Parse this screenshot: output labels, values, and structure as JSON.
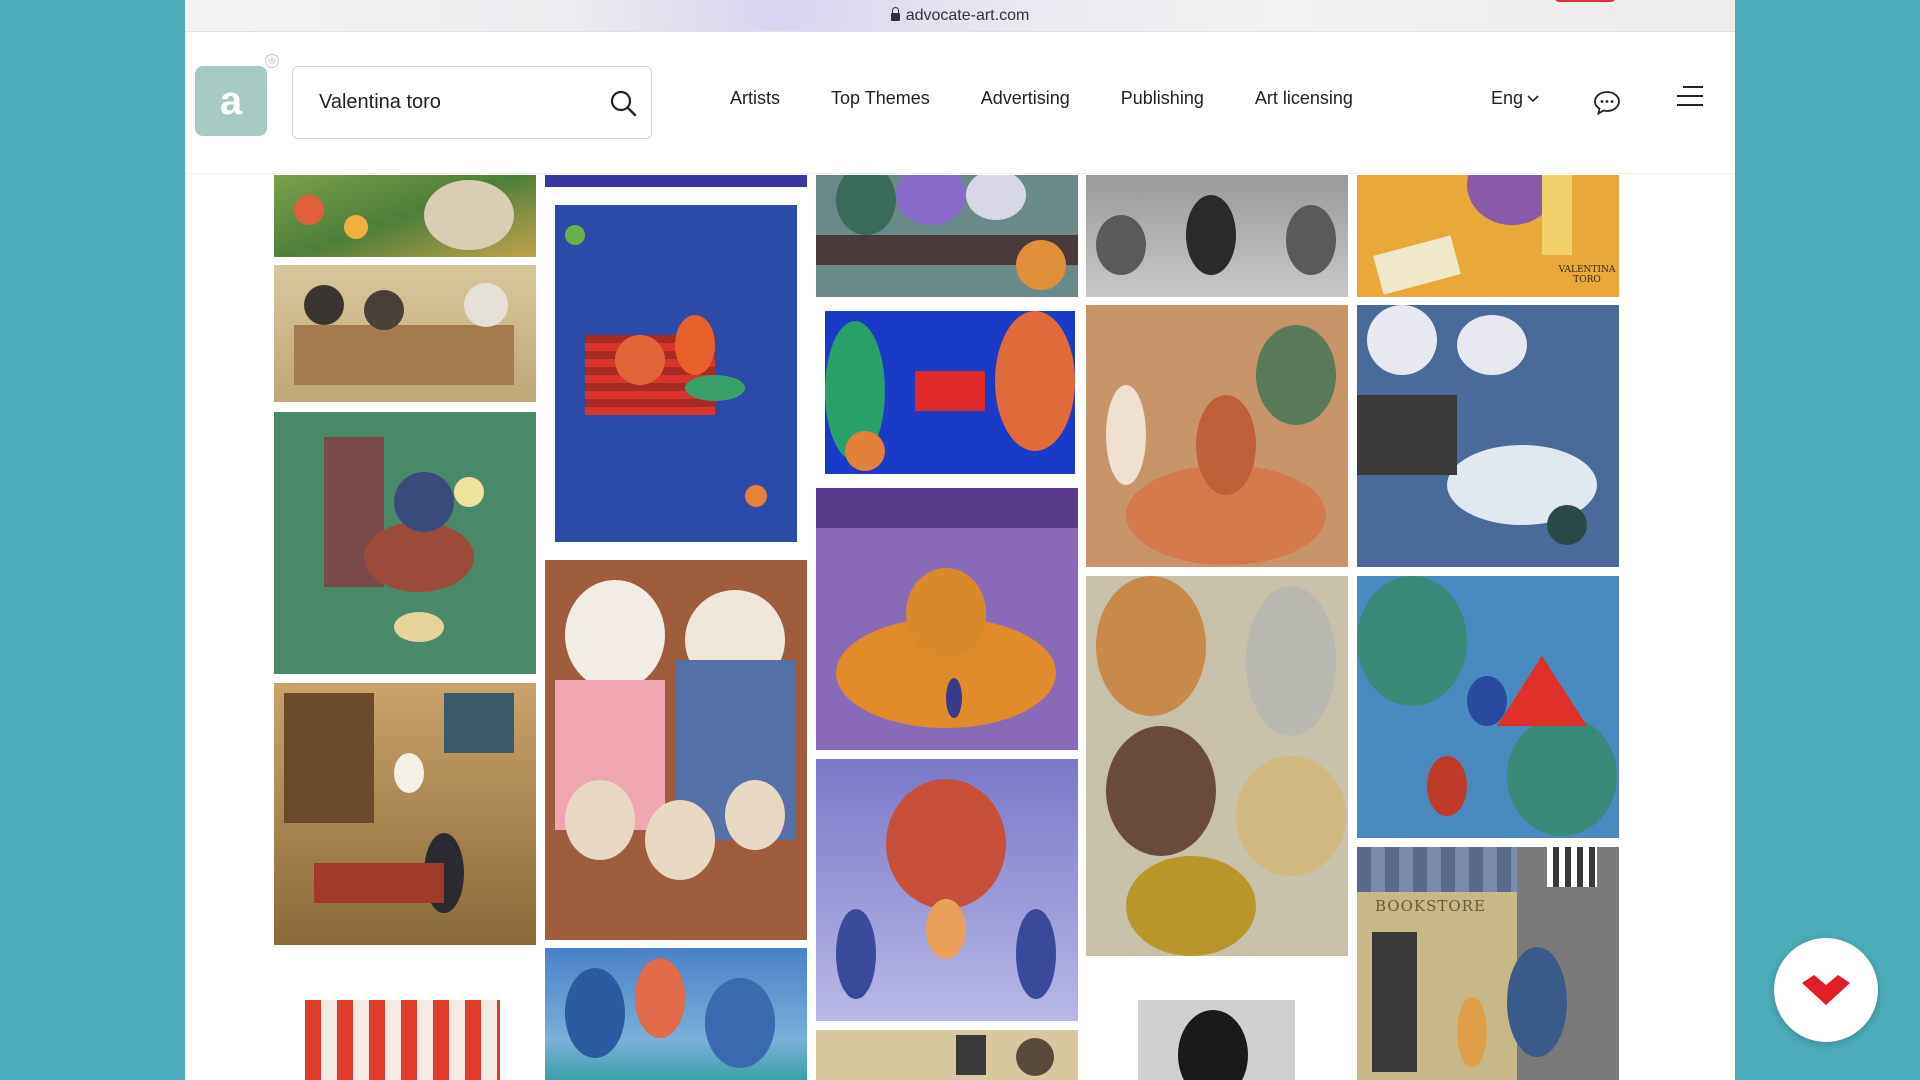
{
  "browser": {
    "url": "advocate-art.com"
  },
  "header": {
    "logo_letter": "a",
    "registered_mark": "®",
    "search": {
      "value": "Valentina toro",
      "placeholder": ""
    },
    "nav": [
      "Artists",
      "Top Themes",
      "Advertising",
      "Publishing",
      "Art licensing"
    ],
    "language": "Eng"
  },
  "colors": {
    "background": "#4cabb8",
    "logo": "#a6c9c4",
    "badge_logo": "#e01e26"
  },
  "icons": {
    "search": "search-icon",
    "chat": "chat-bubble-icon",
    "menu": "hamburger-menu-icon",
    "lock": "lock-icon",
    "chevron": "chevron-down-icon",
    "badge": "domestika-logo-icon"
  },
  "gallery": {
    "artworks": [
      {
        "label": "Valentina Toro illustration"
      }
    ],
    "signature": "VALENTINA TORO",
    "sign_text": "BOOKSTORE"
  }
}
